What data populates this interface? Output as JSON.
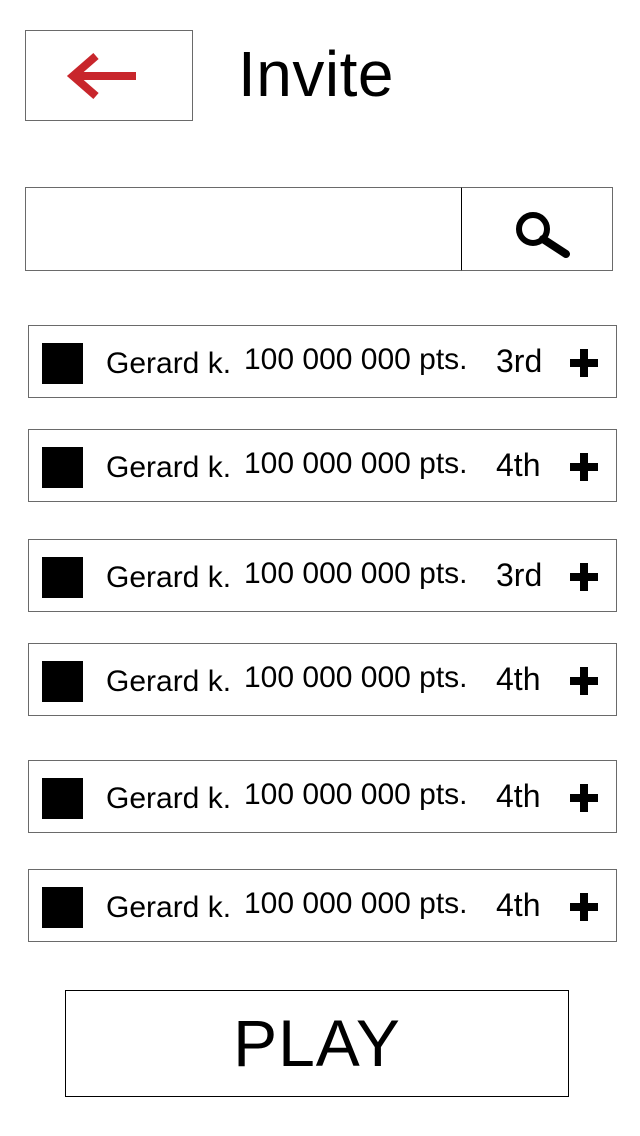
{
  "header": {
    "back_icon": "arrow-left-icon",
    "back_color": "#c8262c",
    "title": "Invite"
  },
  "search": {
    "value": "",
    "placeholder": "",
    "icon": "search-icon"
  },
  "players": [
    {
      "name": "Gerard k.",
      "points": "100 000 000 pts.",
      "rank": "3rd"
    },
    {
      "name": "Gerard k.",
      "points": "100 000 000 pts.",
      "rank": "4th"
    },
    {
      "name": "Gerard k.",
      "points": "100 000 000 pts.",
      "rank": "3rd"
    },
    {
      "name": "Gerard k.",
      "points": "100 000 000 pts.",
      "rank": "4th"
    },
    {
      "name": "Gerard k.",
      "points": "100 000 000 pts.",
      "rank": "4th"
    },
    {
      "name": "Gerard k.",
      "points": "100 000 000 pts.",
      "rank": "4th"
    }
  ],
  "add_icon": "plus-icon",
  "play_label": "PLAY"
}
